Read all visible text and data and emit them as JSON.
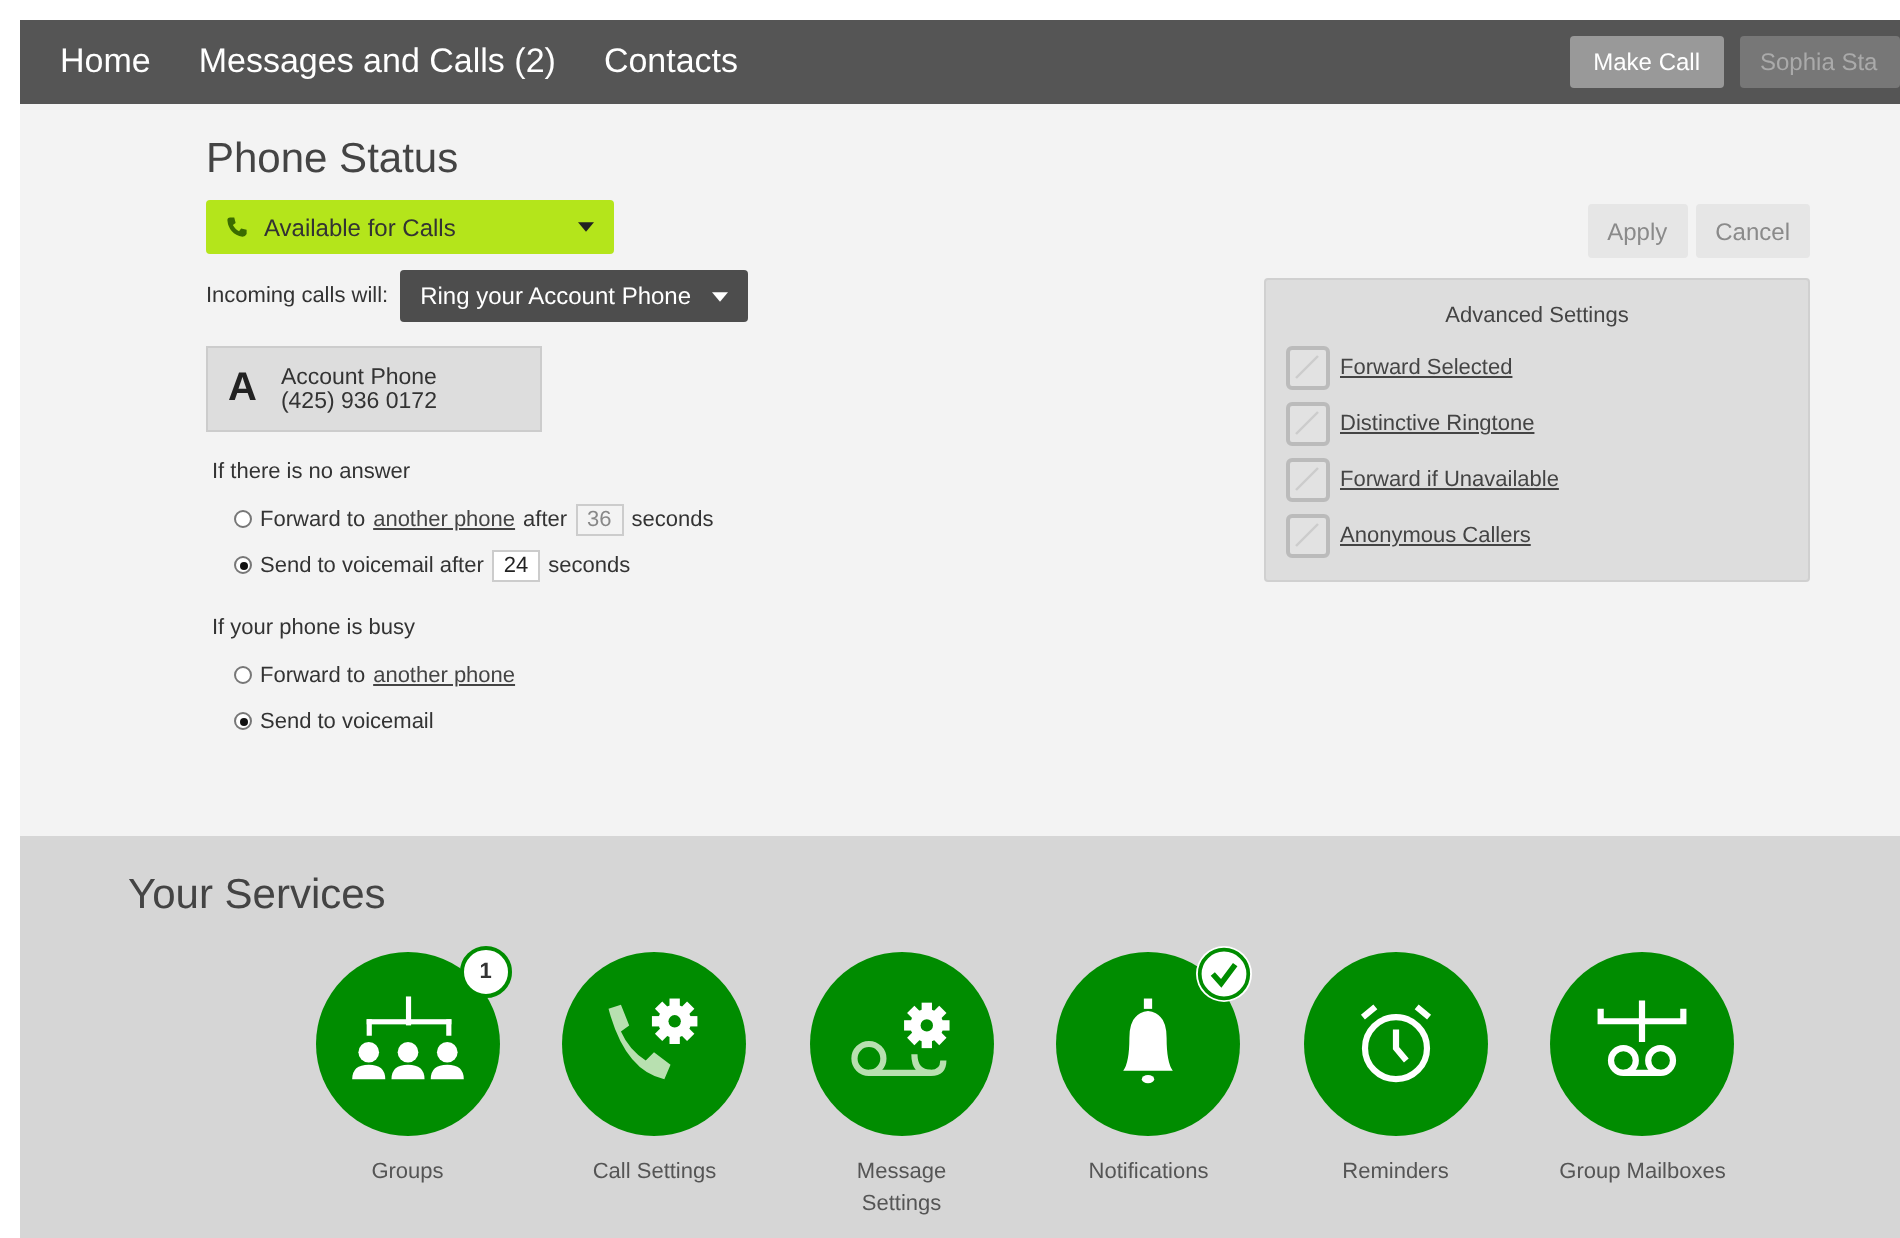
{
  "nav": {
    "items": [
      {
        "label": "Home",
        "selected": false
      },
      {
        "label": "Messages and Calls (2)",
        "selected": false
      },
      {
        "label": "Contacts",
        "selected": false
      }
    ],
    "make_call": "Make Call",
    "user": "Sophia Sta"
  },
  "phone_status": {
    "title": "Phone Status",
    "availability": "Available for Calls",
    "incoming_label": "Incoming calls will:",
    "incoming_value": "Ring your Account Phone",
    "account": {
      "letter": "A",
      "name": "Account Phone",
      "number": "(425) 936 0172"
    },
    "groups": [
      {
        "title": "If there is no answer",
        "options": [
          {
            "selected": false,
            "parts": [
              {
                "kind": "text",
                "text": "Forward to"
              },
              {
                "kind": "link",
                "text": "another phone"
              },
              {
                "kind": "text",
                "text": "after"
              },
              {
                "kind": "input",
                "value": "36",
                "disabled": true
              },
              {
                "kind": "text",
                "text": "seconds"
              }
            ]
          },
          {
            "selected": true,
            "parts": [
              {
                "kind": "text",
                "text": "Send to voicemail after"
              },
              {
                "kind": "input",
                "value": "24",
                "disabled": false
              },
              {
                "kind": "text",
                "text": "seconds"
              }
            ]
          }
        ]
      },
      {
        "title": "If your phone is busy",
        "options": [
          {
            "selected": false,
            "parts": [
              {
                "kind": "text",
                "text": "Forward to"
              },
              {
                "kind": "link",
                "text": "another phone"
              }
            ]
          },
          {
            "selected": true,
            "parts": [
              {
                "kind": "text",
                "text": "Send to voicemail"
              }
            ]
          }
        ]
      }
    ],
    "buttons": [
      {
        "label": "Apply",
        "disabled": true
      },
      {
        "label": "Cancel",
        "disabled": true
      }
    ],
    "advanced": {
      "title": "Advanced Settings",
      "items": [
        "Forward Selected",
        "Distinctive Ringtone",
        "Forward if Unavailable",
        "Anonymous Callers"
      ]
    }
  },
  "services": {
    "title": "Your Services",
    "items": [
      {
        "kind": "groups",
        "label": "Groups",
        "badge": {
          "kind": "count",
          "text": "1"
        }
      },
      {
        "kind": "call",
        "label": "Call Settings"
      },
      {
        "kind": "message",
        "label": "Message Settings"
      },
      {
        "kind": "bell",
        "label": "Notifications",
        "badge": {
          "kind": "check"
        }
      },
      {
        "kind": "clock",
        "label": "Reminders"
      },
      {
        "kind": "mailbox",
        "label": "Group Mailboxes"
      }
    ]
  }
}
